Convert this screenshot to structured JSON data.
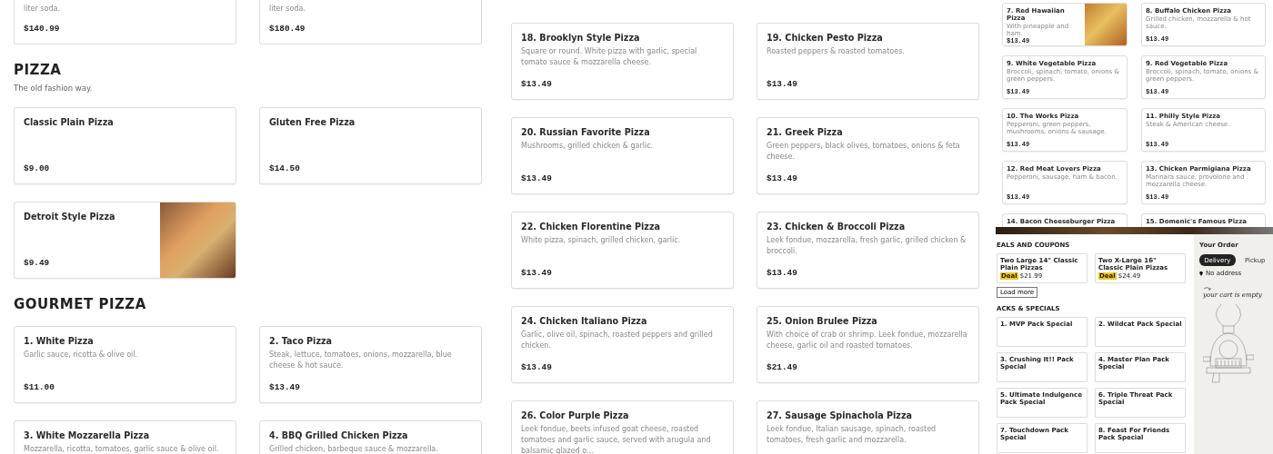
{
  "menu_column": {
    "top_cards": [
      {
        "description": "liter soda.",
        "price": "$140.99"
      },
      {
        "description": "liter soda.",
        "price": "$180.49"
      }
    ],
    "sections": [
      {
        "title": "PIZZA",
        "subtitle": "The old fashion way.",
        "items": [
          {
            "name": "Classic Plain Pizza",
            "price": "$9.00",
            "photo": false
          },
          {
            "name": "Gluten Free Pizza",
            "price": "$14.50",
            "photo": false
          },
          {
            "name": "Detroit Style Pizza",
            "price": "$9.49",
            "photo": true
          }
        ]
      },
      {
        "title": "GOURMET PIZZA",
        "items": [
          {
            "name": "1. White Pizza",
            "description": "Garlic sauce, ricotta & olive oil.",
            "price": "$11.00",
            "photo": false
          },
          {
            "name": "2. Taco Pizza",
            "description": "Steak, lettuce, tomatoes, onions, mozzarella, blue cheese & hot sauce.",
            "price": "$13.49",
            "photo": false
          },
          {
            "name": "3. White Mozzarella Pizza",
            "description": "Mozzarella, ricotta, tomatoes, garlic sauce & olive oil.",
            "photo": false
          },
          {
            "name": "4. BBQ Grilled Chicken Pizza",
            "description": "Grilled chicken, barbeque sauce & mozzarella.",
            "photo": false
          }
        ]
      }
    ]
  },
  "gourmet_column": {
    "items": [
      {
        "name": "18. Brooklyn Style Pizza",
        "description": "Square or round. White pizza with garlic, special tomato sauce & mozzarella cheese.",
        "price": "$13.49"
      },
      {
        "name": "19. Chicken Pesto Pizza",
        "description": "Roasted peppers & roasted tomatoes.",
        "price": "$13.49"
      },
      {
        "name": "20. Russian Favorite Pizza",
        "description": "Mushrooms, grilled chicken & garlic.",
        "price": "$13.49"
      },
      {
        "name": "21. Greek Pizza",
        "description": "Green peppers, black olives, tomatoes, onions & feta cheese.",
        "price": "$13.49"
      },
      {
        "name": "22. Chicken Florentine Pizza",
        "description": "White pizza, spinach, grilled chicken, garlic.",
        "price": "$13.49"
      },
      {
        "name": "23. Chicken & Broccoli Pizza",
        "description": "Leek fondue, mozzarella, fresh garlic, grilled chicken & broccoli.",
        "price": "$13.49"
      },
      {
        "name": "24. Chicken Italiano Pizza",
        "description": "Garlic, olive oil, spinach, roasted peppers and grilled chicken.",
        "price": "$13.49"
      },
      {
        "name": "25. Onion Brulee Pizza",
        "description": "With choice of crab or shrimp. Leek fondue, mozzarella cheese, garlic oil and roasted tomatoes.",
        "price": "$21.49"
      },
      {
        "name": "26. Color Purple Pizza",
        "description": "Leek fondue, beets infused goat cheese, roasted tomatoes and garlic sauce, served with arugula and balsamic glazed o..."
      },
      {
        "name": "27. Sausage Spinachola Pizza",
        "description": "Leek fondue, Italian sausage, spinach, roasted tomatoes, fresh garlic and mozzarella."
      }
    ]
  },
  "thumbnail_menu": {
    "items": [
      {
        "name": "7. Red Hawaiian Pizza",
        "description": "With pineapple and ham.",
        "price": "$13.49",
        "photo": true
      },
      {
        "name": "8. Buffalo Chicken Pizza",
        "description": "Grilled chicken, mozzarella & hot sauce.",
        "price": "$13.49",
        "photo": false
      },
      {
        "name": "9. White Vegetable Pizza",
        "description": "Broccoli, spinach, tomato, onions & green peppers.",
        "price": "$13.49",
        "photo": false
      },
      {
        "name": "9. Red Vegetable Pizza",
        "description": "Broccoli, spinach, tomato, onions & green peppers.",
        "price": "$13.49",
        "photo": false
      },
      {
        "name": "10. The Works Pizza",
        "description": "Pepperoni, green peppers, mushrooms, onions & sausage.",
        "price": "$13.49",
        "photo": false
      },
      {
        "name": "11. Philly Style Pizza",
        "description": "Steak & American cheese.",
        "price": "$13.49",
        "photo": false
      },
      {
        "name": "12. Red Meat Lovers Pizza",
        "description": "Pepperoni, sausage, ham & bacon.",
        "price": "$13.49",
        "photo": false
      },
      {
        "name": "13. Chicken Parmigiana Pizza",
        "description": "Marinara sauce, provolone and mozzarella cheese.",
        "price": "$13.49",
        "photo": false
      },
      {
        "name": "14. Bacon Cheeseburger Pizza",
        "photo": false
      },
      {
        "name": "15. Domenic's Famous Pizza",
        "photo": false
      }
    ]
  },
  "thumbnail_order": {
    "deals": {
      "title": "EALS AND COUPONS",
      "items": [
        {
          "name": "Two Large 14\" Classic Plain Pizzas",
          "badge": "Deal",
          "price": "$21.99"
        },
        {
          "name": "Two X-Large 16\" Classic Plain Pizzas",
          "badge": "Deal",
          "price": "$24.49"
        }
      ],
      "load_more": "Load more"
    },
    "packs": {
      "title": "ACKS & SPECIALS",
      "items": [
        {
          "name": "1. MVP Pack Special"
        },
        {
          "name": "2. Wildcat Pack Special"
        },
        {
          "name": "3. Crushing It!! Pack Special"
        },
        {
          "name": "4. Master Plan Pack Special"
        },
        {
          "name": "5. Ultimate Indulgence Pack Special"
        },
        {
          "name": "6. Triple Threat Pack Special"
        },
        {
          "name": "7. Touchdown Pack Special"
        },
        {
          "name": "8. Feast For Friends Pack Special"
        }
      ]
    },
    "order": {
      "title": "Your Order",
      "modes": [
        {
          "label": "Delivery",
          "selected": true
        },
        {
          "label": "Pickup",
          "selected": false
        }
      ],
      "address": "No address",
      "cart_message": "your cart is empty"
    }
  }
}
